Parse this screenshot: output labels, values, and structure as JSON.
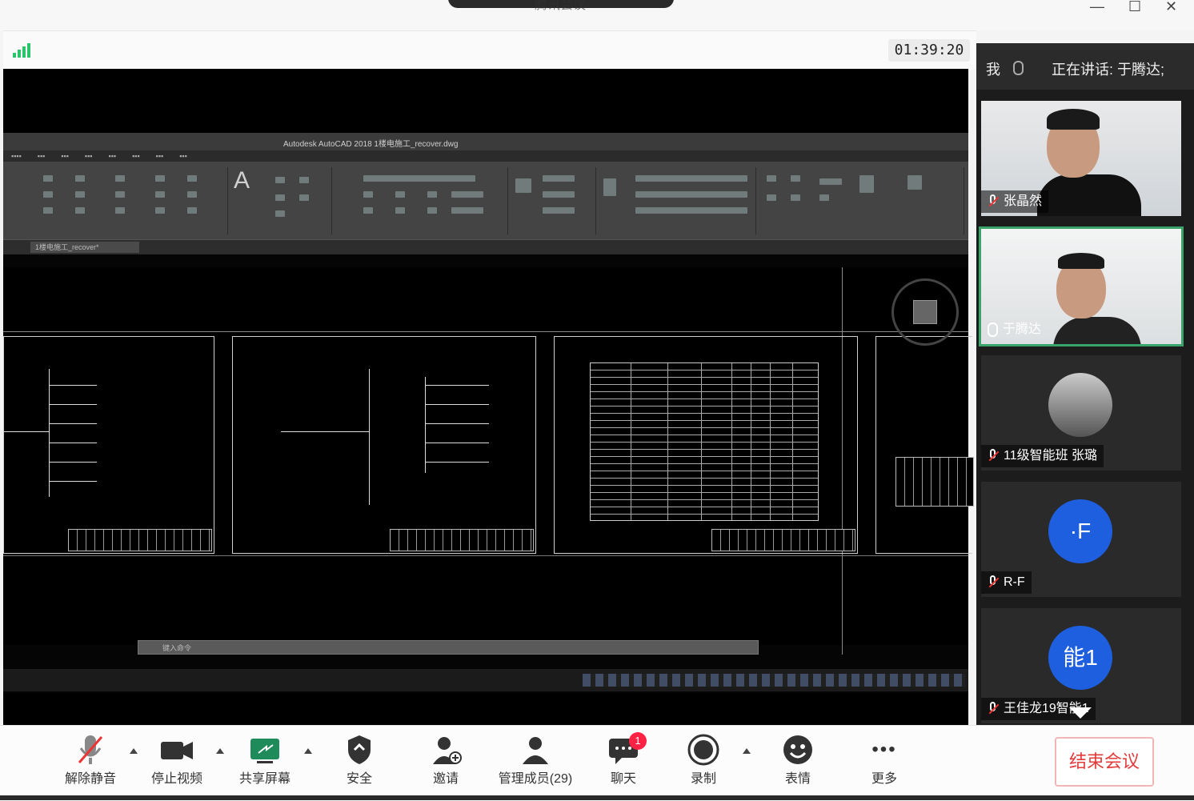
{
  "window": {
    "title": "腾讯会议",
    "minimize": "—",
    "maximize": "☐",
    "close": "✕"
  },
  "timer": "01:39:20",
  "cad": {
    "app_title": "Autodesk AutoCAD 2018   1楼电施工_recover.dwg",
    "file_tab": "1楼电施工_recover*",
    "big_A": "A",
    "cmd_placeholder": "键入命令"
  },
  "panel": {
    "me_label": "我",
    "speaking": "正在讲话: 于腾达;",
    "participants": [
      {
        "name": "张晶然",
        "type": "video"
      },
      {
        "name": "于腾达",
        "type": "video",
        "active": true
      },
      {
        "name": "11级智能班 张璐",
        "type": "avatar-photo"
      },
      {
        "name": "R-F",
        "type": "avatar",
        "initial": "·F",
        "color": "#1e5fe0"
      },
      {
        "name": "王佳龙19智能1",
        "type": "avatar",
        "initial": "能1",
        "color": "#1e5fe0"
      }
    ]
  },
  "toolbar": {
    "unmute": "解除静音",
    "stop_video": "停止视频",
    "share_screen": "共享屏幕",
    "security": "安全",
    "invite": "邀请",
    "manage_members": "管理成员(29)",
    "chat": "聊天",
    "chat_badge": "1",
    "record": "录制",
    "reaction": "表情",
    "more": "更多",
    "more_glyph": "•••",
    "end_meeting": "结束会议"
  },
  "colors": {
    "accent_green": "#2ac46a",
    "end_red": "#e23b3b",
    "avatar_blue": "#1e5fe0"
  }
}
